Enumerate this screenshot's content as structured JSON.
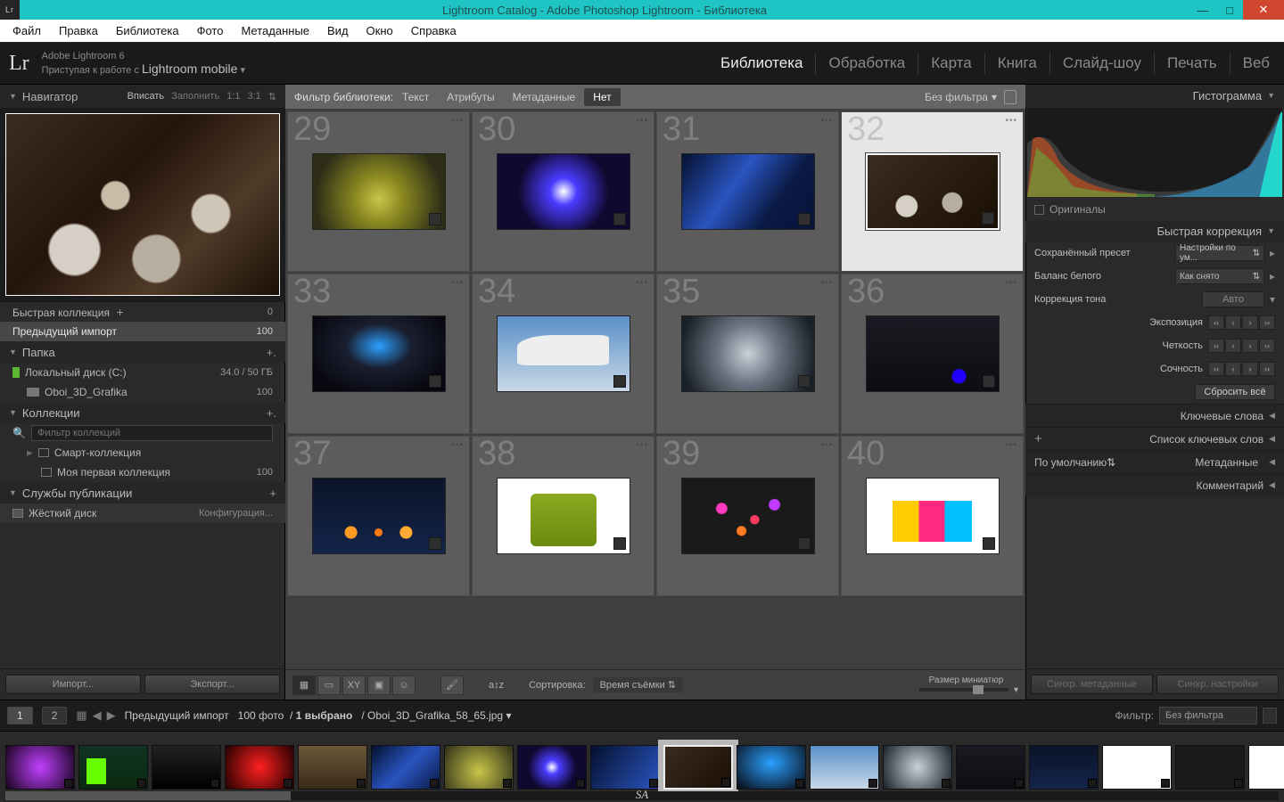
{
  "window": {
    "title": "Lightroom Catalog - Adobe Photoshop Lightroom - Библиотека"
  },
  "menubar": [
    "Файл",
    "Правка",
    "Библиотека",
    "Фото",
    "Метаданные",
    "Вид",
    "Окно",
    "Справка"
  ],
  "identity": {
    "product": "Adobe Lightroom 6",
    "tagline_prefix": "Приступая к работе с ",
    "tagline_bold": "Lightroom mobile",
    "logo": "Lr"
  },
  "modules": [
    {
      "label": "Библиотека",
      "active": true
    },
    {
      "label": "Обработка"
    },
    {
      "label": "Карта"
    },
    {
      "label": "Книга"
    },
    {
      "label": "Слайд-шоу"
    },
    {
      "label": "Печать"
    },
    {
      "label": "Веб"
    }
  ],
  "navigator": {
    "title": "Навигатор",
    "zoom_opts": [
      "Вписать",
      "Заполнить",
      "1:1",
      "3:1"
    ],
    "zoom_active": "Вписать"
  },
  "catalog_rows": [
    {
      "name": "Быстрая коллекция",
      "suffix": "+",
      "count": "0"
    },
    {
      "name": "Предыдущий импорт",
      "count": "100",
      "selected": true
    }
  ],
  "folders": {
    "title": "Папка",
    "volume": {
      "name": "Локальный диск (C:)",
      "space": "34.0 / 50 ГБ"
    },
    "items": [
      {
        "name": "Oboi_3D_Grafika",
        "count": "100"
      }
    ]
  },
  "collections": {
    "title": "Коллекции",
    "filter_placeholder": "Фильтр коллекций",
    "items": [
      {
        "name": "Смарт-коллекция",
        "count": ""
      },
      {
        "name": "Моя первая коллекция",
        "count": "100"
      }
    ]
  },
  "publish": {
    "title": "Службы публикации",
    "hd": "Жёсткий диск",
    "config": "Конфигурация..."
  },
  "left_buttons": {
    "import": "Импорт...",
    "export": "Экспорт..."
  },
  "filterbar": {
    "label": "Фильтр библиотеки:",
    "tabs": [
      "Текст",
      "Атрибуты",
      "Метаданные",
      "Нет"
    ],
    "active": "Нет",
    "dropdown": "Без фильтра"
  },
  "grid": {
    "start_index": 29,
    "cells": [
      29,
      30,
      31,
      32,
      33,
      34,
      35,
      36,
      37,
      38,
      39,
      40
    ],
    "selected": 32
  },
  "center_toolbar": {
    "sort_label": "Сортировка:",
    "sort_value": "Время съёмки",
    "size_label": "Размер миниатюр"
  },
  "right": {
    "histogram": "Гистограмма",
    "originals": "Оригиналы",
    "quick_dev": "Быстрая коррекция",
    "preset_label": "Сохранённый пресет",
    "preset_value": "Настройки по ум...",
    "wb_label": "Баланс белого",
    "wb_value": "Как снято",
    "tone_label": "Коррекция тона",
    "auto": "Авто",
    "exposure": "Экспозиция",
    "clarity": "Четкость",
    "vibrance": "Сочность",
    "reset": "Сбросить всё",
    "keywords": "Ключевые слова",
    "keyword_list": "Список ключевых слов",
    "metadata": "Метаданные",
    "metadata_mode": "По умолчанию",
    "comment": "Комментарий",
    "sync_meta": "Синхр. метаданные",
    "sync_settings": "Синхр. настройки"
  },
  "infostrip": {
    "pages": [
      "1",
      "2"
    ],
    "active_page": "1",
    "crumb": "Предыдущий импорт",
    "count_photos": "100 фото",
    "count_sel": "1 выбрано",
    "sep": "/",
    "filename": "Oboi_3D_Grafika_58_65.jpg",
    "filter_label": "Фильтр:",
    "filter_value": "Без фильтра"
  },
  "footer_mark": "SA"
}
